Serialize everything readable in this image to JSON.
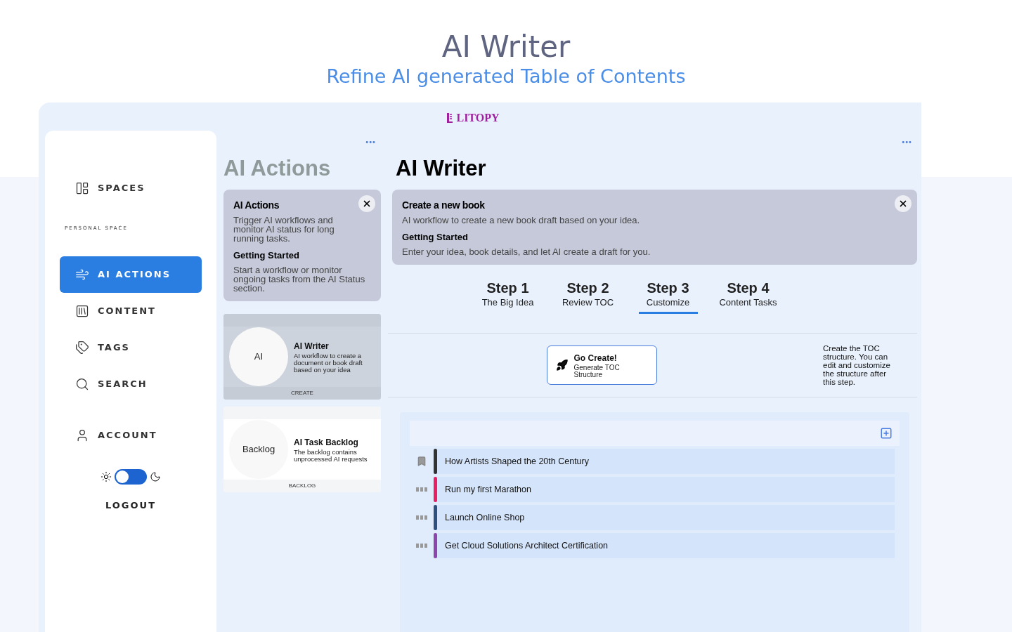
{
  "header": {
    "title": "AI Writer",
    "subtitle": "Refine AI generated Table of Contents"
  },
  "app": {
    "logo": "LITOPY",
    "sidebar": {
      "items": [
        {
          "label": "SPACES",
          "selected": false
        },
        {
          "label": "AI ACTIONS",
          "selected": true
        },
        {
          "label": "CONTENT",
          "selected": false
        },
        {
          "label": "TAGS",
          "selected": false
        },
        {
          "label": "SEARCH",
          "selected": false
        },
        {
          "label": "ACCOUNT",
          "selected": false
        }
      ],
      "section_label": "PERSONAL SPACE",
      "dark_mode": false,
      "logout": "LOGOUT"
    },
    "actions": {
      "menu": "•••",
      "title": "AI Actions",
      "info": {
        "title": "AI Actions",
        "text": "Trigger AI workflows and monitor AI status for long running tasks.",
        "subtitle": "Getting Started",
        "subtext": "Start a workflow or monitor ongoing tasks from the AI Status section."
      },
      "cards": [
        {
          "badge": "AI",
          "title": "AI Writer",
          "text": "AI workflow to create a document or book draft based on your idea",
          "footer": "CREATE",
          "selected": true
        },
        {
          "badge": "Backlog",
          "title": "AI Task Backlog",
          "text": "The backlog contains unprocessed AI requests",
          "footer": "BACKLOG",
          "selected": false
        }
      ]
    },
    "writer": {
      "menu": "•••",
      "title": "AI Writer",
      "info": {
        "title": "Create a new book",
        "text": "AI workflow to create a new book draft based on your idea.",
        "subtitle": "Getting Started",
        "subtext": "Enter your idea, book details, and let AI create a draft for you."
      },
      "steps": [
        {
          "title": "Step 1",
          "label": "The Big Idea",
          "selected": false
        },
        {
          "title": "Step 2",
          "label": "Review TOC",
          "selected": false
        },
        {
          "title": "Step 3",
          "label": "Customize",
          "selected": true
        },
        {
          "title": "Step 4",
          "label": "Content Tasks",
          "selected": false
        }
      ],
      "action": {
        "title": "Go Create!",
        "text": "Generate TOC Structure"
      },
      "hint": "Create the TOC structure. You can edit and customize the structure after this step.",
      "toc": [
        {
          "kind": "book",
          "title": "How Artists Shaped the 20th Century",
          "color": "#333333"
        },
        {
          "kind": "text",
          "title": "Run my first Marathon",
          "color": "#e91e63"
        },
        {
          "kind": "text",
          "title": "Launch Online Shop",
          "color": "#2f4f7f"
        },
        {
          "kind": "text",
          "title": "Get Cloud Solutions Architect Certification",
          "color": "#8e44ad"
        }
      ]
    }
  }
}
